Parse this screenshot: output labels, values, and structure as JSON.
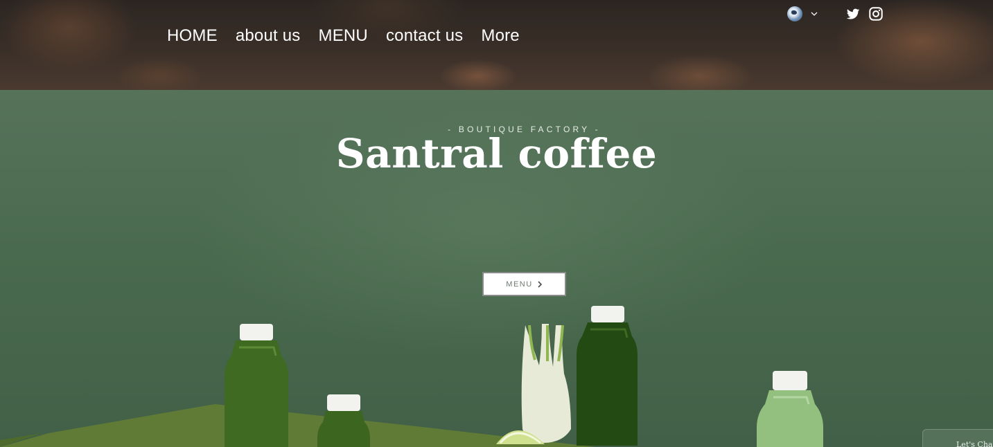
{
  "header": {
    "nav": [
      "HOME",
      "about us",
      "MENU",
      "contact us",
      "More"
    ],
    "language_icon": "globe-icon",
    "language_dropdown_icon": "chevron-down-icon",
    "social_icons": [
      "twitter-icon",
      "instagram-icon"
    ]
  },
  "hero": {
    "tagline": "- BOUTIQUE FACTORY -",
    "title": "Santral coffee",
    "menu_button": "MENU",
    "menu_button_icon": "chevron-right-icon"
  },
  "chat": {
    "label": "Let's Chat!"
  },
  "colors": {
    "hero_green": "#4a6a4f",
    "header_brown": "#3a2f28",
    "text_white": "#ffffff"
  }
}
